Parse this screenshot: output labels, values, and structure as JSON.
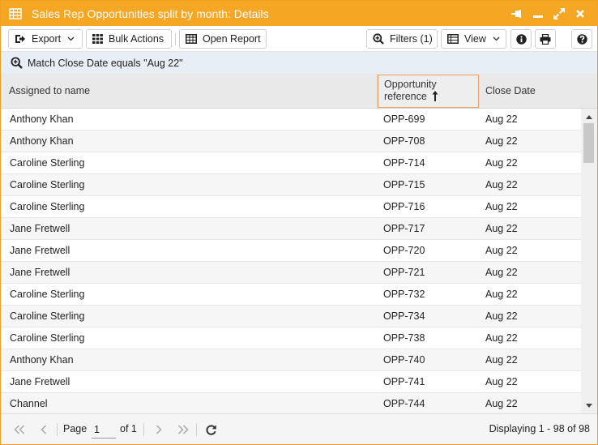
{
  "window": {
    "title": "Sales Rep Opportunities split by month: Details",
    "accent_color": "#f5a623"
  },
  "toolbar": {
    "export_label": "Export",
    "bulk_actions_label": "Bulk Actions",
    "open_report_label": "Open Report",
    "filters_label": "Filters (1)",
    "view_label": "View"
  },
  "filter": {
    "text": "Match Close Date equals \"Aug 22\""
  },
  "grid": {
    "columns": [
      {
        "label": "Assigned to name"
      },
      {
        "label_line1": "Opportunity",
        "label_line2": "reference",
        "sorted": "ascending"
      },
      {
        "label": "Close Date"
      }
    ],
    "rows": [
      [
        "Anthony Khan",
        "OPP-699",
        "Aug 22"
      ],
      [
        "Anthony Khan",
        "OPP-708",
        "Aug 22"
      ],
      [
        "Caroline Sterling",
        "OPP-714",
        "Aug 22"
      ],
      [
        "Caroline Sterling",
        "OPP-715",
        "Aug 22"
      ],
      [
        "Caroline Sterling",
        "OPP-716",
        "Aug 22"
      ],
      [
        "Jane Fretwell",
        "OPP-717",
        "Aug 22"
      ],
      [
        "Jane Fretwell",
        "OPP-720",
        "Aug 22"
      ],
      [
        "Jane Fretwell",
        "OPP-721",
        "Aug 22"
      ],
      [
        "Caroline Sterling",
        "OPP-732",
        "Aug 22"
      ],
      [
        "Caroline Sterling",
        "OPP-734",
        "Aug 22"
      ],
      [
        "Caroline Sterling",
        "OPP-738",
        "Aug 22"
      ],
      [
        "Anthony Khan",
        "OPP-740",
        "Aug 22"
      ],
      [
        "Jane Fretwell",
        "OPP-741",
        "Aug 22"
      ],
      [
        "Channel",
        "OPP-744",
        "Aug 22"
      ]
    ]
  },
  "pager": {
    "page_label": "Page",
    "page_value": "1",
    "of_label": "of 1",
    "display_text": "Displaying 1 - 98 of 98"
  }
}
